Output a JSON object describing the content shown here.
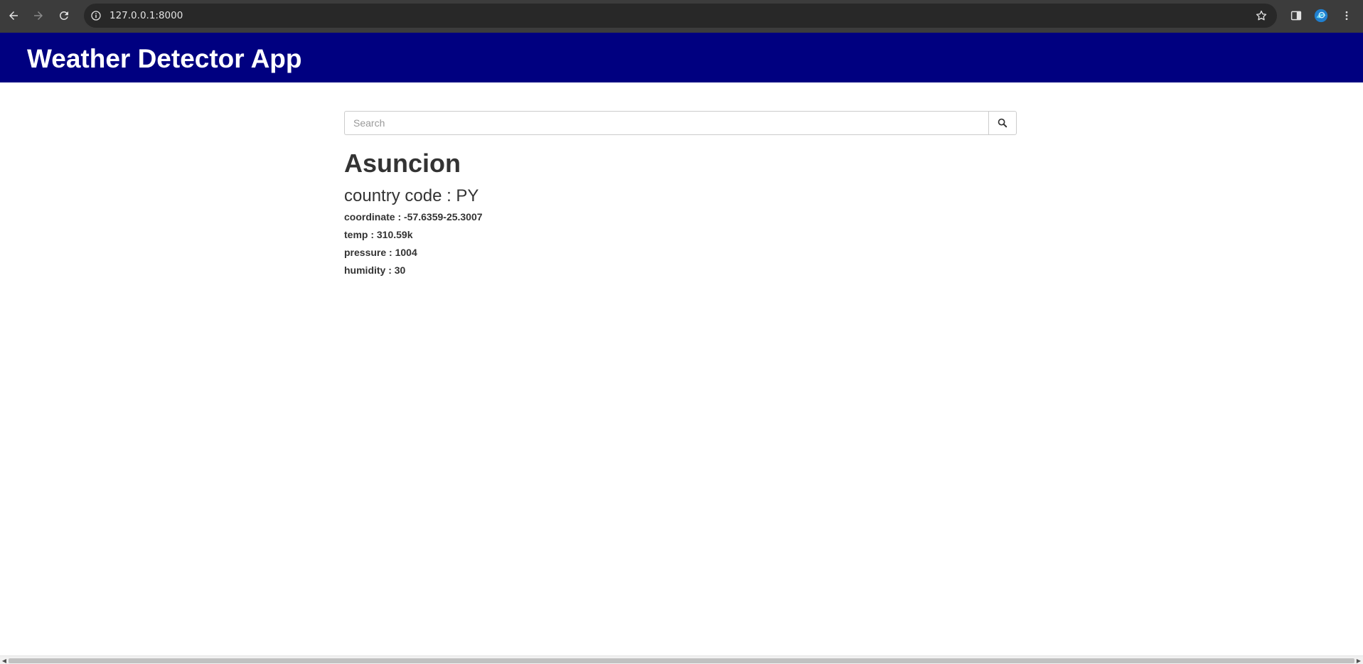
{
  "browser": {
    "url": "127.0.0.1:8000"
  },
  "icons": {
    "back": "arrow-left-icon",
    "forward": "arrow-right-icon",
    "reload": "reload-icon",
    "site_info": "info-icon",
    "bookmark": "star-icon",
    "side_panel": "side-panel-icon",
    "profile": "profile-icon",
    "menu": "kebab-menu-icon",
    "search": "search-icon"
  },
  "colors": {
    "navbar": "#000080",
    "brand_text": "#ffffff",
    "text": "#333333"
  },
  "navbar": {
    "brand": "Weather Detector App"
  },
  "search": {
    "placeholder": "Search",
    "value": ""
  },
  "weather": {
    "city": "Asuncion",
    "country_line": "country code : PY",
    "coordinate_line": "coordinate : -57.6359-25.3007",
    "temp_line": "temp : 310.59k",
    "pressure_line": "pressure : 1004",
    "humidity_line": "humidity : 30"
  }
}
